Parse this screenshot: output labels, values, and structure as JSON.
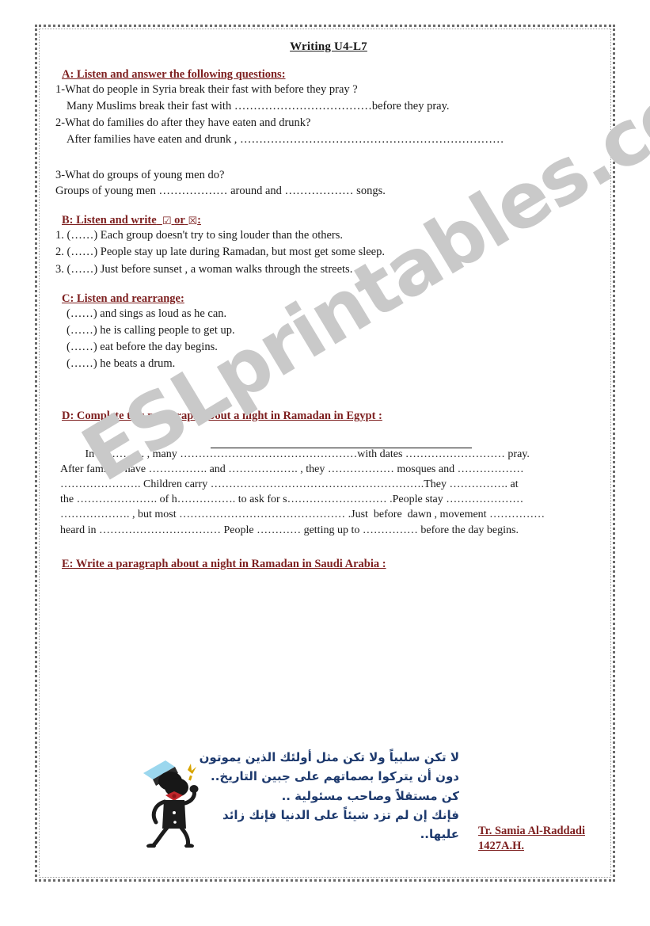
{
  "document": {
    "title": "Writing U4-L7",
    "watermark": "ESLprintables.com"
  },
  "section_a": {
    "heading": "A: Listen and answer the following questions:",
    "q1": "1-What do people in Syria break their fast with before they pray ?",
    "a1": "Many Muslims break their fast with ………………………………before they pray.",
    "q2": "2-What do families do after they have eaten and drunk?",
    "a2": "After families have eaten and drunk , ……………………………………………………………",
    "q3": "3-What do groups of young men do?",
    "a3": "Groups of young men ……………… around and ……………… songs."
  },
  "section_b": {
    "heading_before": "B: Listen and write",
    "check_symbol": "☑",
    "heading_or": "or",
    "cross_symbol": "☒",
    "heading_colon": ":",
    "items": [
      "1. (……) Each group doesn't try to sing louder than the others.",
      "2. (……) People  stay up late during Ramadan, but most get some sleep.",
      "3. (……) Just before sunset , a woman walks through the streets."
    ]
  },
  "section_c": {
    "heading": "C: Listen and rearrange:",
    "items": [
      "(……) and sings as loud as he can.",
      "(……) he is calling people to get up.",
      "(……) eat before the day begins.",
      "(……) he beats a drum."
    ]
  },
  "section_d": {
    "heading": "D: Complete this paragraph about a night in Ramadan in Egypt :",
    "lines": [
      "         In …………. , many …………………………………………with dates ……………………… pray.",
      "After families have ……………. and ………………. , they ……………… mosques and ………………",
      "…………………. Children carry ………………………………………………….They ……………. at",
      "the …………………. of h……………. to ask for s……………………… .People stay …………………",
      "………………. , but most ……………………………………… .Just  before  dawn , movement ……………",
      "heard in …………………………… People ………… getting up to …………… before the day begins."
    ]
  },
  "section_e": {
    "heading": "E: Write a paragraph about a night in Ramadan in Saudi Arabia :",
    "blank_line_count": 7
  },
  "footer": {
    "arabic_lines": [
      "لا تكن سلبياً ولا تكن مثل أولئك الذين يموتون",
      "دون أن يتركوا بصماتهم على جبين التاريخ..",
      "كن مستقلاً وصاحب مسئولية ..",
      "فإنك إن لم تزد شيئاً على الدنيا فإنك زائد عليها..",
      ""
    ],
    "teacher_name": "Tr. Samia Al-Raddadi",
    "teacher_year": "1427A.H."
  },
  "colors": {
    "heading_red": "#7d1f1f",
    "arabic_blue": "#1e3a6e",
    "body_black": "#1a1a1a",
    "watermark_gray": "#c9c9c9"
  }
}
